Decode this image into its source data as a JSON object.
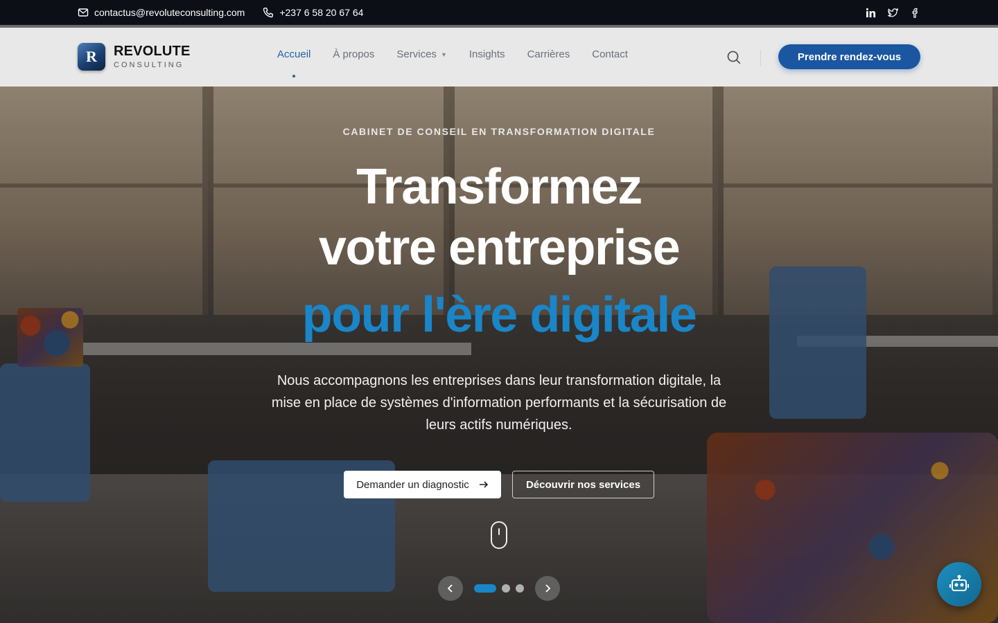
{
  "topbar": {
    "email": "contactus@revoluteconsulting.com",
    "phone": "+237 6 58 20 67 64",
    "social": [
      "linkedin-icon",
      "twitter-icon",
      "facebook-icon"
    ]
  },
  "header": {
    "logo_mark": "R",
    "logo_title": "REVOLUTE",
    "logo_subtitle": "CONSULTING",
    "nav": [
      {
        "label": "Accueil",
        "active": true
      },
      {
        "label": "À propos"
      },
      {
        "label": "Services",
        "dropdown": true
      },
      {
        "label": "Insights"
      },
      {
        "label": "Carrières"
      },
      {
        "label": "Contact"
      }
    ],
    "cta_label": "Prendre rendez-vous"
  },
  "hero": {
    "eyebrow": "CABINET DE CONSEIL EN TRANSFORMATION DIGITALE",
    "title_line1": "Transformez",
    "title_line2": "votre entreprise",
    "title_line3": "pour l'ère digitale",
    "subtitle": "Nous accompagnons les entreprises dans leur transformation digitale, la mise en place de systèmes d'information performants et la sécurisation de leurs actifs numériques.",
    "primary_button": "Demander un diagnostic",
    "secondary_button": "Découvrir nos services",
    "slider": {
      "total": 3,
      "active": 1
    }
  },
  "colors": {
    "accent": "#1a86c8",
    "brand": "#1b56a0",
    "topbar_bg": "#0c0f16"
  }
}
